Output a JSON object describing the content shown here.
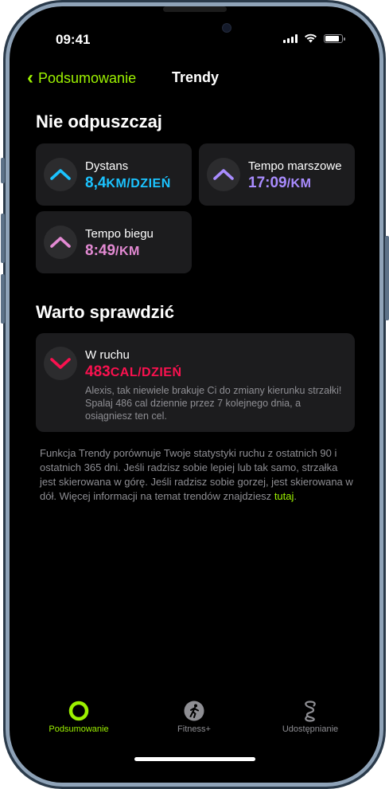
{
  "status_bar": {
    "time": "09:41"
  },
  "nav": {
    "back_label": "Podsumowanie",
    "title": "Trendy"
  },
  "sections": {
    "keep_up": "Nie odpuszczaj",
    "check": "Warto sprawdzić"
  },
  "cards": {
    "distance": {
      "label": "Dystans",
      "value": "8,4",
      "unit": "KM/DZIEŃ",
      "color": "#1bc3ff",
      "direction": "up"
    },
    "walk_pace": {
      "label": "Tempo marszowe",
      "value": "17:09",
      "unit": "/KM",
      "color": "#a98cff",
      "direction": "up"
    },
    "run_pace": {
      "label": "Tempo biegu",
      "value": "8:49",
      "unit": "/KM",
      "color": "#e38ad3",
      "direction": "up"
    },
    "move": {
      "label": "W ruchu",
      "value": "483",
      "unit": "CAL/DZIEŃ",
      "color": "#fa114f",
      "direction": "down",
      "message": "Alexis, tak niewiele brakuje Ci do zmiany kierunku strzałki! Spalaj 486 cal dziennie przez 7 kolejnego dnia, a osiągniesz ten cel."
    }
  },
  "footnote": {
    "text": "Funkcja Trendy porównuje Twoje statystyki ruchu z ostatnich 90 i ostatnich 365 dni. Jeśli radzisz sobie lepiej lub tak samo, strzałka jest skierowana w górę. Jeśli radzisz sobie gorzej, jest skierowana w dół. Więcej informacji na temat trendów znajdziesz",
    "link": "tutaj",
    "end": "."
  },
  "tabs": [
    {
      "label": "Podsumowanie",
      "icon": "activity-ring-icon",
      "active": true
    },
    {
      "label": "Fitness+",
      "icon": "running-figure-icon",
      "active": false
    },
    {
      "label": "Udostępnianie",
      "icon": "sharing-icon",
      "active": false
    }
  ],
  "colors": {
    "accent": "#9cf100",
    "background": "#000000",
    "card": "#1c1c1e"
  }
}
